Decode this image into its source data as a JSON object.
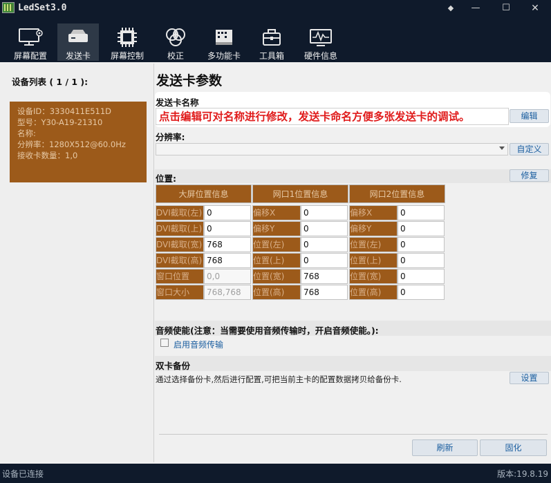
{
  "window": {
    "title": "LedSet3.0",
    "controls": {
      "pin": "◆",
      "minimize": "—",
      "maximize": "☐",
      "close": "✕"
    }
  },
  "toolbar": {
    "items": [
      {
        "label": "屏幕配置",
        "icon": "monitor-gear-icon"
      },
      {
        "label": "发送卡",
        "icon": "sender-card-icon",
        "active": true
      },
      {
        "label": "屏幕控制",
        "icon": "chip-icon"
      },
      {
        "label": "校正",
        "icon": "color-circles-icon"
      },
      {
        "label": "多功能卡",
        "icon": "multifunction-card-icon"
      },
      {
        "label": "工具箱",
        "icon": "toolbox-icon"
      },
      {
        "label": "硬件信息",
        "icon": "waveform-monitor-icon"
      }
    ]
  },
  "left": {
    "heading": "设备列表 ( 1 / 1 ):",
    "device": {
      "lines": [
        "设备ID：3330411E511D",
        "型号：Y30-A19-21310",
        "名称:",
        "分辨率：1280X512@60.0Hz",
        "接收卡数量：1,0"
      ]
    }
  },
  "main": {
    "title": "发送卡参数",
    "name_section": {
      "label": "发送卡名称",
      "value": "点击编辑可对名称进行修改，发送卡命名方便多张发送卡的调试。",
      "edit_button": "编辑"
    },
    "resolution": {
      "label": "分辨率:",
      "selected": "",
      "custom_button": "自定义"
    },
    "position": {
      "label": "位置:",
      "repair_button": "修复",
      "columns": [
        {
          "header": "大屏位置信息",
          "rows": [
            {
              "label": "DVI截取(左)",
              "value": "0"
            },
            {
              "label": "DVI截取(上)",
              "value": "0"
            },
            {
              "label": "DVI截取(宽)",
              "value": "768"
            },
            {
              "label": "DVI截取(高)",
              "value": "768"
            },
            {
              "label": "窗口位置",
              "value": "0,0",
              "disabled": true
            },
            {
              "label": "窗口大小",
              "value": "768,768",
              "disabled": true
            }
          ]
        },
        {
          "header": "网口1位置信息",
          "rows": [
            {
              "label": "偏移X",
              "value": "0"
            },
            {
              "label": "偏移Y",
              "value": "0"
            },
            {
              "label": "位置(左)",
              "value": "0"
            },
            {
              "label": "位置(上)",
              "value": "0"
            },
            {
              "label": "位置(宽)",
              "value": "768"
            },
            {
              "label": "位置(高)",
              "value": "768"
            }
          ]
        },
        {
          "header": "网口2位置信息",
          "rows": [
            {
              "label": "偏移X",
              "value": "0"
            },
            {
              "label": "偏移Y",
              "value": "0"
            },
            {
              "label": "位置(左)",
              "value": "0"
            },
            {
              "label": "位置(上)",
              "value": "0"
            },
            {
              "label": "位置(宽)",
              "value": "0"
            },
            {
              "label": "位置(高)",
              "value": "0"
            }
          ]
        }
      ]
    },
    "audio": {
      "label": "音频使能(注意：当需要使用音频传输时，开启音频使能。):",
      "checkbox_label": "启用音频传输",
      "checked": false
    },
    "backup": {
      "label": "双卡备份",
      "description": "通过选择备份卡,然后进行配置,可把当前主卡的配置数据拷贝给备份卡.",
      "settings_button": "设置"
    },
    "footer": {
      "refresh_button": "刷新",
      "solidify_button": "固化"
    }
  },
  "status": {
    "left": "设备已连接",
    "right": "版本:19.8.19"
  },
  "colors": {
    "chrome": "#0f1a2b",
    "card_brown": "#9c5a1a",
    "name_red": "#e01b1b",
    "link_blue": "#1c5fa0"
  }
}
